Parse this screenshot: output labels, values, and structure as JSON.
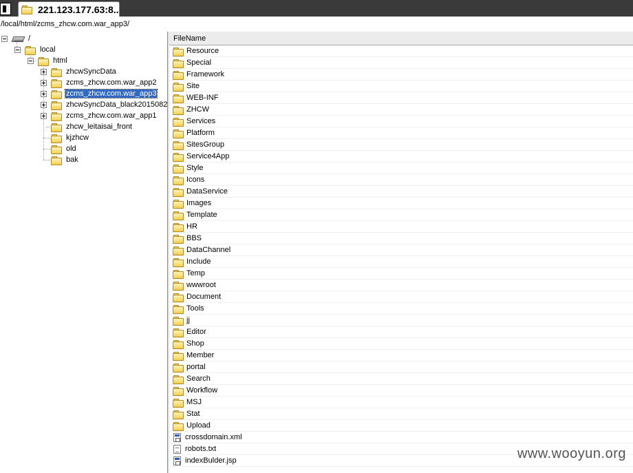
{
  "tab": {
    "title": "221.123.177.63:8..."
  },
  "path": "/local/html/zcms_zhcw.com.war_app3/",
  "tree": {
    "root": "/",
    "local": "local",
    "html": "html",
    "children": [
      "zhcwSyncData",
      "zcms_zhcw.com.war_app2",
      "zcms_zhcw.com.war_app3",
      "zhcwSyncData_black2015082",
      "zcms_zhcw.com.war_app1",
      "zhcw_leitaisai_front",
      "kjzhcw",
      "old",
      "bak"
    ]
  },
  "list": {
    "column": "FileName",
    "items": [
      {
        "name": "Resource",
        "type": "folder"
      },
      {
        "name": "Special",
        "type": "folder"
      },
      {
        "name": "Framework",
        "type": "folder"
      },
      {
        "name": "Site",
        "type": "folder"
      },
      {
        "name": "WEB-INF",
        "type": "folder"
      },
      {
        "name": "ZHCW",
        "type": "folder"
      },
      {
        "name": "Services",
        "type": "folder"
      },
      {
        "name": "Platform",
        "type": "folder"
      },
      {
        "name": "SitesGroup",
        "type": "folder"
      },
      {
        "name": "Service4App",
        "type": "folder"
      },
      {
        "name": "Style",
        "type": "folder"
      },
      {
        "name": "Icons",
        "type": "folder"
      },
      {
        "name": "DataService",
        "type": "folder"
      },
      {
        "name": "Images",
        "type": "folder"
      },
      {
        "name": "Template",
        "type": "folder"
      },
      {
        "name": "HR",
        "type": "folder"
      },
      {
        "name": "BBS",
        "type": "folder"
      },
      {
        "name": "DataChannel",
        "type": "folder"
      },
      {
        "name": "Include",
        "type": "folder"
      },
      {
        "name": "Temp",
        "type": "folder"
      },
      {
        "name": "wwwroot",
        "type": "folder"
      },
      {
        "name": "Document",
        "type": "folder"
      },
      {
        "name": "Tools",
        "type": "folder"
      },
      {
        "name": "jj",
        "type": "folder"
      },
      {
        "name": "Editor",
        "type": "folder"
      },
      {
        "name": "Shop",
        "type": "folder"
      },
      {
        "name": "Member",
        "type": "folder"
      },
      {
        "name": "portal",
        "type": "folder"
      },
      {
        "name": "Search",
        "type": "folder"
      },
      {
        "name": "Workflow",
        "type": "folder"
      },
      {
        "name": "MSJ",
        "type": "folder"
      },
      {
        "name": "Stat",
        "type": "folder"
      },
      {
        "name": "Upload",
        "type": "folder"
      },
      {
        "name": "crossdomain.xml",
        "type": "app"
      },
      {
        "name": "robots.txt",
        "type": "doc"
      },
      {
        "name": "indexBulder.jsp",
        "type": "app"
      }
    ]
  },
  "watermark": "www.wooyun.org"
}
